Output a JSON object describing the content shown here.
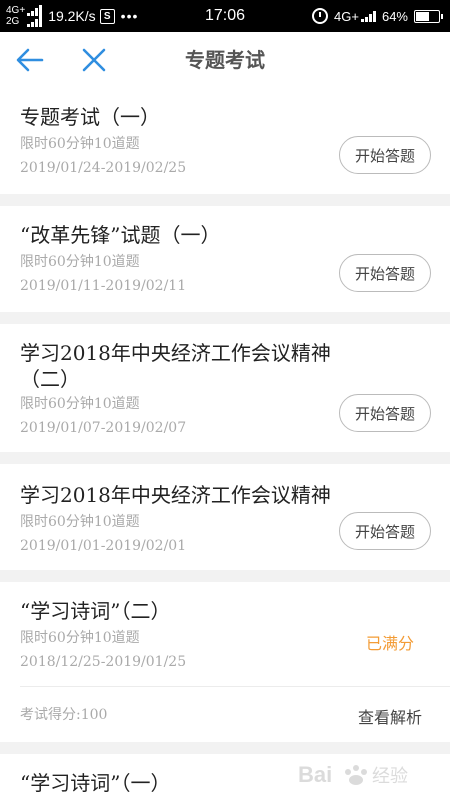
{
  "status_bar": {
    "network_top": "4G+",
    "network_bottom": "2G",
    "speed": "19.2K/s",
    "s_icon": "S",
    "more_dots": "•••",
    "time": "17:06",
    "network_right": "4G+",
    "battery": "64%",
    "battery_level": 0.64
  },
  "header": {
    "title": "专题考试",
    "back_icon": "arrow-left-icon",
    "close_icon": "close-icon",
    "accent_color": "#2f8ee0"
  },
  "exams": [
    {
      "title": "专题考试（一）",
      "limit": "限时60分钟10道题",
      "date_range": "2019/01/24-2019/02/25",
      "action": "开始答题"
    },
    {
      "title": "“改革先锋”试题（一）",
      "limit": "限时60分钟10道题",
      "date_range": "2019/01/11-2019/02/11",
      "action": "开始答题"
    },
    {
      "title": "学习2018年中央经济工作会议精神（二）",
      "limit": "限时60分钟10道题",
      "date_range": "2019/01/07-2019/02/07",
      "action": "开始答题"
    },
    {
      "title": "学习2018年中央经济工作会议精神",
      "limit": "限时60分钟10道题",
      "date_range": "2019/01/01-2019/02/01",
      "action": "开始答题"
    },
    {
      "title": "“学习诗词”（二）",
      "limit": "限时60分钟10道题",
      "date_range": "2018/12/25-2019/01/25",
      "status": "已满分",
      "score": "考试得分:100",
      "analysis": "查看解析",
      "status_color": "#f39c36"
    },
    {
      "title": "“学习诗词”（一）"
    }
  ],
  "watermark": {
    "text": "Bai",
    "icon": "paw-icon",
    "suffix": "经验"
  }
}
